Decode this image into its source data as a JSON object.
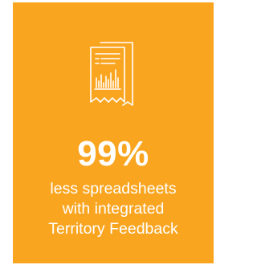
{
  "card": {
    "background_color": "#f9a520",
    "icon": "spreadsheet-report-icon",
    "stat_value": "99%",
    "caption_lines": [
      "less spreadsheets",
      "with integrated",
      "Territory Feedback"
    ]
  }
}
